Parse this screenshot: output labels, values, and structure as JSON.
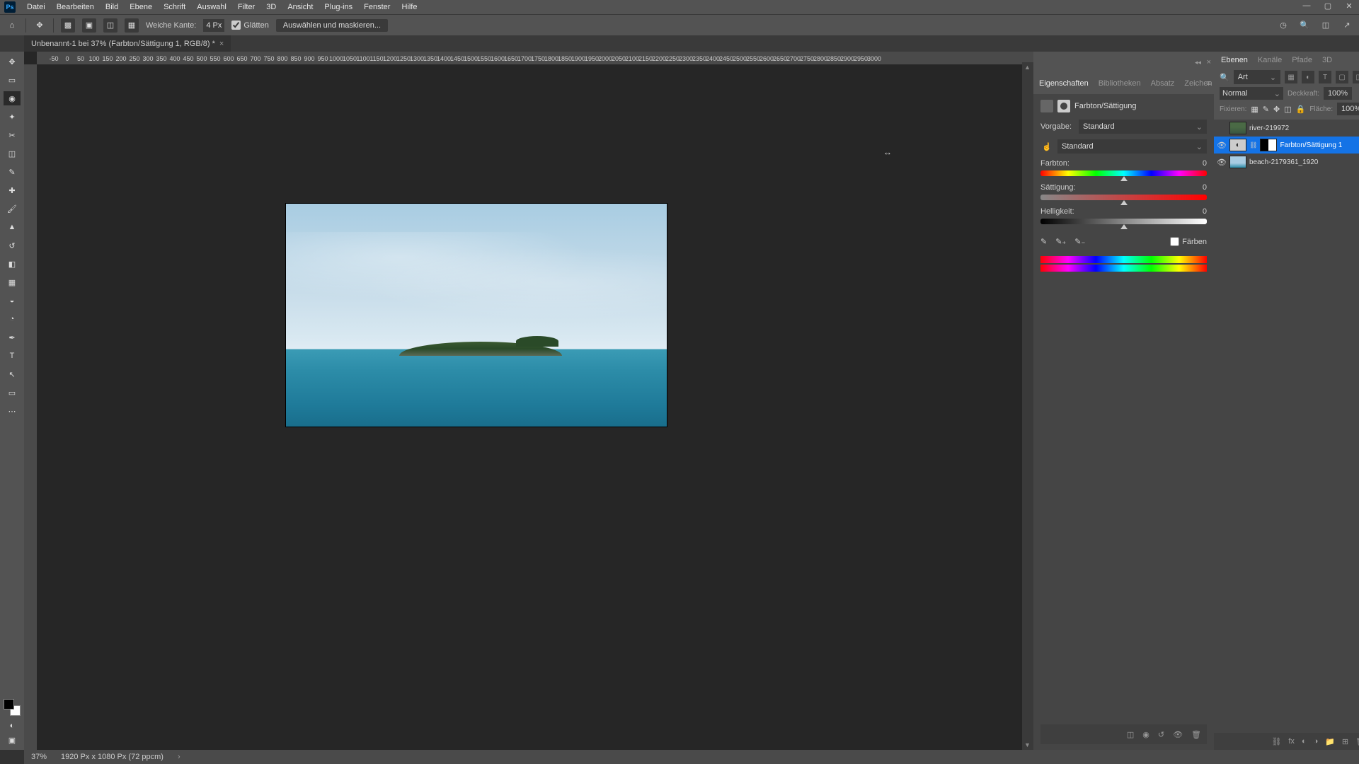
{
  "menu": [
    "Datei",
    "Bearbeiten",
    "Bild",
    "Ebene",
    "Schrift",
    "Auswahl",
    "Filter",
    "3D",
    "Ansicht",
    "Plug-ins",
    "Fenster",
    "Hilfe"
  ],
  "optbar": {
    "feather_label": "Weiche Kante:",
    "feather_value": "4 Px",
    "smooth": "Glätten",
    "mask": "Auswählen und maskieren..."
  },
  "doctab": "Unbenannt-1 bei 37% (Farbton/Sättigung 1, RGB/8) *",
  "ruler": [
    "-50",
    "0",
    "50",
    "100",
    "150",
    "200",
    "250",
    "300",
    "350",
    "400",
    "450",
    "500",
    "550",
    "600",
    "650",
    "700",
    "750",
    "800",
    "850",
    "900",
    "950",
    "1000",
    "1050",
    "1100",
    "1150",
    "1200",
    "1250",
    "1300",
    "1350",
    "1400",
    "1450",
    "1500",
    "1550",
    "1600",
    "1650",
    "1700",
    "1750",
    "1800",
    "1850",
    "1900",
    "1950",
    "2000",
    "2050",
    "2100",
    "2150",
    "2200",
    "2250",
    "2300",
    "2350",
    "2400",
    "2450",
    "2500",
    "2550",
    "2600",
    "2650",
    "2700",
    "2750",
    "2800",
    "2850",
    "2900",
    "2950",
    "3000"
  ],
  "prop": {
    "tabs": {
      "t1": "Eigenschaften",
      "t2": "Bibliotheken",
      "t3": "Absatz",
      "t4": "Zeichen"
    },
    "title": "Farbton/Sättigung",
    "preset_label": "Vorgabe:",
    "preset": "Standard",
    "range": "Standard",
    "hue_label": "Farbton:",
    "hue_val": "0",
    "sat_label": "Sättigung:",
    "sat_val": "0",
    "lig_label": "Helligkeit:",
    "lig_val": "0",
    "colorize": "Färben"
  },
  "layers": {
    "tabs": {
      "t1": "Ebenen",
      "t2": "Kanäle",
      "t3": "Pfade",
      "t4": "3D"
    },
    "search": "Art",
    "blend": "Normal",
    "opacity_label": "Deckkraft:",
    "opacity": "100%",
    "lock_label": "Fixieren:",
    "fill_label": "Fläche:",
    "fill": "100%",
    "l1": "river-219972",
    "l2": "Farbton/Sättigung 1",
    "l3": "beach-2179361_1920"
  },
  "status": {
    "zoom": "37%",
    "info": "1920 Px x 1080 Px (72 ppcm)"
  }
}
